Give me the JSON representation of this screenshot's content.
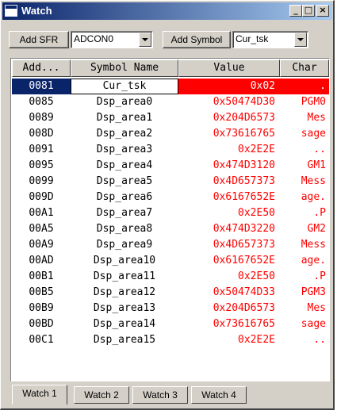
{
  "window": {
    "title": "Watch"
  },
  "titlebar_buttons": {
    "minimize": "_",
    "maximize": "□",
    "close": "×"
  },
  "toolbar": {
    "add_sfr_label": "Add SFR",
    "sfr_selected": "ADCON0",
    "add_symbol_label": "Add Symbol",
    "symbol_selected": "Cur_tsk"
  },
  "columns": [
    "Add...",
    "Symbol Name",
    "Value",
    "Char"
  ],
  "rows": [
    {
      "address": "0081",
      "symbol": "Cur_tsk",
      "value": "0x02",
      "char": "."
    },
    {
      "address": "0085",
      "symbol": "Dsp_area0",
      "value": "0x50474D30",
      "char": "PGM0"
    },
    {
      "address": "0089",
      "symbol": "Dsp_area1",
      "value": "0x204D6573",
      "char": "Mes"
    },
    {
      "address": "008D",
      "symbol": "Dsp_area2",
      "value": "0x73616765",
      "char": "sage"
    },
    {
      "address": "0091",
      "symbol": "Dsp_area3",
      "value": "0x2E2E",
      "char": ".."
    },
    {
      "address": "0095",
      "symbol": "Dsp_area4",
      "value": "0x474D3120",
      "char": "GM1"
    },
    {
      "address": "0099",
      "symbol": "Dsp_area5",
      "value": "0x4D657373",
      "char": "Mess"
    },
    {
      "address": "009D",
      "symbol": "Dsp_area6",
      "value": "0x6167652E",
      "char": "age."
    },
    {
      "address": "00A1",
      "symbol": "Dsp_area7",
      "value": "0x2E50",
      "char": ".P"
    },
    {
      "address": "00A5",
      "symbol": "Dsp_area8",
      "value": "0x474D3220",
      "char": "GM2"
    },
    {
      "address": "00A9",
      "symbol": "Dsp_area9",
      "value": "0x4D657373",
      "char": "Mess"
    },
    {
      "address": "00AD",
      "symbol": "Dsp_area10",
      "value": "0x6167652E",
      "char": "age."
    },
    {
      "address": "00B1",
      "symbol": "Dsp_area11",
      "value": "0x2E50",
      "char": ".P"
    },
    {
      "address": "00B5",
      "symbol": "Dsp_area12",
      "value": "0x50474D33",
      "char": "PGM3"
    },
    {
      "address": "00B9",
      "symbol": "Dsp_area13",
      "value": "0x204D6573",
      "char": "Mes"
    },
    {
      "address": "00BD",
      "symbol": "Dsp_area14",
      "value": "0x73616765",
      "char": "sage"
    },
    {
      "address": "00C1",
      "symbol": "Dsp_area15",
      "value": "0x2E2E",
      "char": ".."
    }
  ],
  "tabs": [
    "Watch 1",
    "Watch 2",
    "Watch 3",
    "Watch 4"
  ],
  "active_tab": "Watch 1",
  "colors": {
    "value_text": "#ff0000",
    "selection": "#0a246a",
    "selected_value_bg": "#ff0000"
  }
}
